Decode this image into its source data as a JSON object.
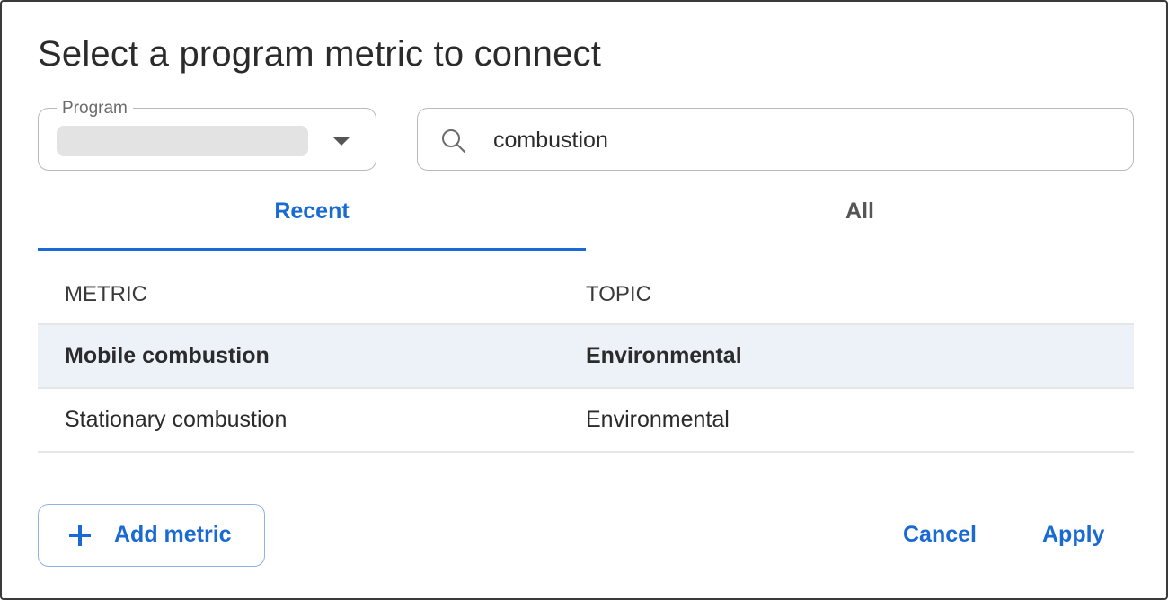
{
  "dialog": {
    "title": "Select a program metric to connect"
  },
  "program_select": {
    "label": "Program",
    "value": ""
  },
  "search": {
    "value": "combustion"
  },
  "tabs": [
    {
      "label": "Recent",
      "active": true
    },
    {
      "label": "All",
      "active": false
    }
  ],
  "table": {
    "headers": {
      "metric": "METRIC",
      "topic": "TOPIC"
    },
    "rows": [
      {
        "metric": "Mobile combustion",
        "topic": "Environmental",
        "selected": true
      },
      {
        "metric": "Stationary combustion",
        "topic": "Environmental",
        "selected": false
      }
    ]
  },
  "footer": {
    "add_metric_label": "Add metric",
    "cancel_label": "Cancel",
    "apply_label": "Apply"
  },
  "colors": {
    "accent": "#1a6ad4",
    "selected_row": "#edf2f9"
  }
}
